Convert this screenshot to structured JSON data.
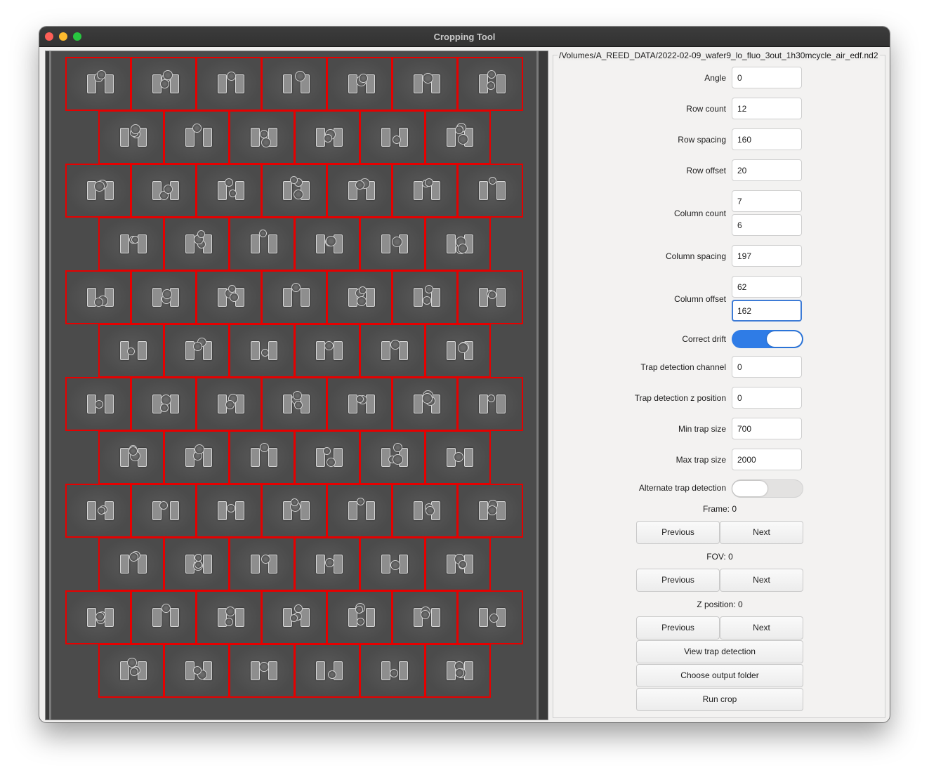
{
  "window": {
    "title": "Cropping Tool",
    "controls": [
      "close",
      "minimize",
      "zoom"
    ]
  },
  "file_path": "/Volumes/A_REED_DATA/2022-02-09_wafer9_lo_fluo_3out_1h30mcycle_air_edf.nd2",
  "viewer": {
    "tile_rows": 12,
    "tiles_per_row_even": 7,
    "tiles_per_row_odd": 6,
    "outline_color": "#e60000"
  },
  "settings": {
    "angle": {
      "label": "Angle",
      "value": "0"
    },
    "row_count": {
      "label": "Row count",
      "value": "12"
    },
    "row_spacing": {
      "label": "Row spacing",
      "value": "160"
    },
    "row_offset": {
      "label": "Row offset",
      "value": "20"
    },
    "column_count": {
      "label": "Column count",
      "value1": "7",
      "value2": "6"
    },
    "column_spacing": {
      "label": "Column spacing",
      "value": "197"
    },
    "column_offset": {
      "label": "Column offset",
      "value1": "62",
      "value2": "162"
    },
    "correct_drift": {
      "label": "Correct drift",
      "on": true
    },
    "trap_detection_channel": {
      "label": "Trap detection channel",
      "value": "0"
    },
    "trap_detection_z": {
      "label": "Trap detection z position",
      "value": "0"
    },
    "min_trap_size": {
      "label": "Min trap size",
      "value": "700"
    },
    "max_trap_size": {
      "label": "Max trap size",
      "value": "2000"
    },
    "alternate_trap_detection": {
      "label": "Alternate trap detection",
      "on": false
    }
  },
  "frame": {
    "text": "Frame:  0"
  },
  "fov": {
    "text": "FOV: 0"
  },
  "zpos": {
    "text": "Z position:  0"
  },
  "buttons": {
    "previous": "Previous",
    "next": "Next",
    "view_trap_detection": "View trap detection",
    "choose_output_folder": "Choose output folder",
    "run_crop": "Run crop"
  },
  "colors": {
    "toggle_on": "#2f7ce6",
    "focus_ring": "#3d7bd6"
  }
}
